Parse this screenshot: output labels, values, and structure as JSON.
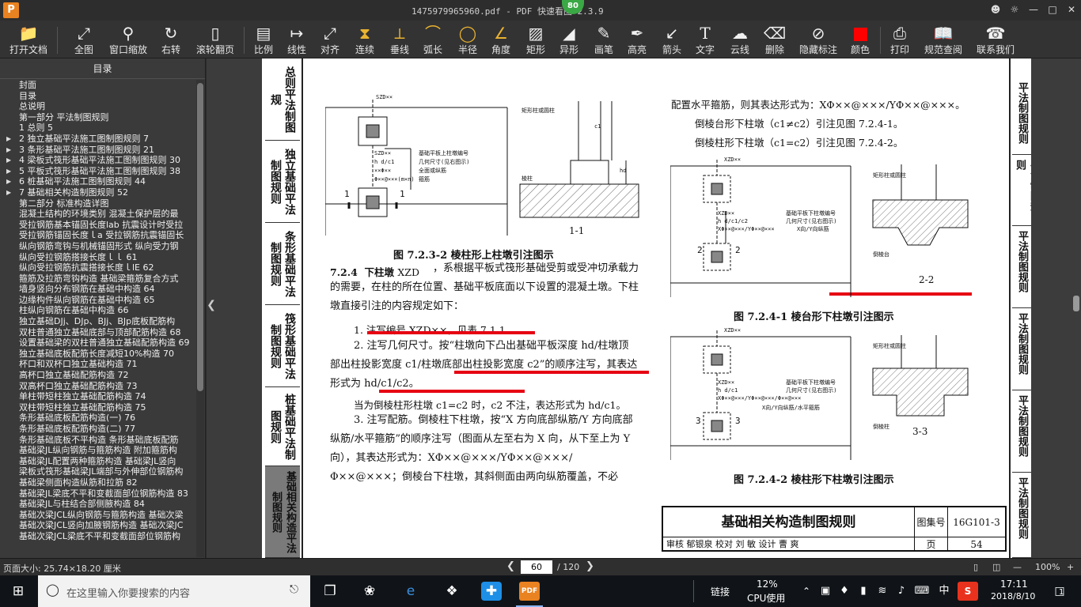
{
  "window": {
    "title": "1475979965960.pdf - PDF 快速看图 2.3.9",
    "badge": "80",
    "app_logo": "P"
  },
  "toolbar": [
    {
      "label": "打开文档",
      "icon": "folder-icon"
    },
    {
      "label": "全图",
      "icon": "fit-page-icon"
    },
    {
      "label": "窗口缩放",
      "icon": "zoom-icon"
    },
    {
      "label": "右转",
      "icon": "rotate-icon"
    },
    {
      "label": "滚轮翻页",
      "icon": "mouse-icon"
    },
    {
      "label": "比例",
      "icon": "scale-icon"
    },
    {
      "label": "线性",
      "icon": "linear-icon"
    },
    {
      "label": "对齐",
      "icon": "align-icon"
    },
    {
      "label": "连续",
      "icon": "continuous-icon"
    },
    {
      "label": "垂线",
      "icon": "perpendicular-icon"
    },
    {
      "label": "弧长",
      "icon": "arc-length-icon"
    },
    {
      "label": "半径",
      "icon": "radius-icon"
    },
    {
      "label": "角度",
      "icon": "angle-icon"
    },
    {
      "label": "矩形",
      "icon": "rectangle-icon"
    },
    {
      "label": "异形",
      "icon": "polygon-icon"
    },
    {
      "label": "画笔",
      "icon": "pen-icon"
    },
    {
      "label": "高亮",
      "icon": "highlight-icon"
    },
    {
      "label": "箭头",
      "icon": "arrow-icon"
    },
    {
      "label": "文字",
      "icon": "text-icon"
    },
    {
      "label": "云线",
      "icon": "cloud-icon"
    },
    {
      "label": "删除",
      "icon": "eraser-icon"
    },
    {
      "label": "隐藏标注",
      "icon": "hide-eye-icon"
    },
    {
      "label": "颜色",
      "icon": "color-swatch-icon"
    },
    {
      "label": "打印",
      "icon": "printer-icon"
    },
    {
      "label": "规范查阅",
      "icon": "book-icon"
    },
    {
      "label": "联系我们",
      "icon": "headset-icon"
    }
  ],
  "colors": {
    "accent_red": "#e60012",
    "swatch": "#ff0000",
    "badge": "#3aa845"
  },
  "toc": {
    "header": "目录",
    "items": [
      {
        "label": "封面",
        "arrow": false
      },
      {
        "label": "目录",
        "arrow": false
      },
      {
        "label": "总说明",
        "arrow": false
      },
      {
        "label": "第一部分  平法制图规则",
        "arrow": false
      },
      {
        "label": "1 总则 5",
        "arrow": false
      },
      {
        "label": "2 独立基础平法施工图制图规则 7",
        "arrow": true
      },
      {
        "label": "3 条形基础平法施工图制图规则 21",
        "arrow": true
      },
      {
        "label": "4 梁板式筏形基础平法施工图制图规则 30",
        "arrow": true
      },
      {
        "label": "5 平板式筏形基础平法施工图制图规则 38",
        "arrow": true
      },
      {
        "label": "6 桩基础平法施工图制图规则 44",
        "arrow": true
      },
      {
        "label": "7 基础相关构造制图规则 52",
        "arrow": true
      },
      {
        "label": "第二部分  标准构造详图",
        "arrow": false
      },
      {
        "label": "混凝土结构的环境类别 混凝土保护层的最",
        "arrow": false
      },
      {
        "label": "受拉钢筋基本锚固长度lab 抗震设计时受拉",
        "arrow": false
      },
      {
        "label": "受拉钢筋锚固长度ｌa 受拉钢筋抗震锚固长",
        "arrow": false
      },
      {
        "label": "纵向钢筋弯钩与机械锚固形式 纵向受力钢",
        "arrow": false
      },
      {
        "label": "纵向受拉钢筋搭接长度ｌｌ 61",
        "arrow": false
      },
      {
        "label": "纵向受拉钢筋抗震搭接长度ｌlE 62",
        "arrow": false
      },
      {
        "label": "箍筋及拉筋弯钩构造 基础梁箍筋复合方式",
        "arrow": false
      },
      {
        "label": "墙身竖向分布钢筋在基础中构造 64",
        "arrow": false
      },
      {
        "label": "边缘构件纵向钢筋在基础中构造 65",
        "arrow": false
      },
      {
        "label": "柱纵向钢筋在基础中构造 66",
        "arrow": false
      },
      {
        "label": "独立基础DJj、DJp、BJj、BJp底板配筋构",
        "arrow": false
      },
      {
        "label": "双柱普通独立基础底部与顶部配筋构造 68",
        "arrow": false
      },
      {
        "label": "设置基础梁的双柱普通独立基础配筋构造 69",
        "arrow": false
      },
      {
        "label": "独立基础底板配筋长度减短10%构造 70",
        "arrow": false
      },
      {
        "label": "杯口和双杯口独立基础构造 71",
        "arrow": false
      },
      {
        "label": "高杯口独立基础配筋构造 72",
        "arrow": false
      },
      {
        "label": "双高杯口独立基础配筋构造 73",
        "arrow": false
      },
      {
        "label": "单柱带短柱独立基础配筋构造 74",
        "arrow": false
      },
      {
        "label": "双柱带短柱独立基础配筋构造 75",
        "arrow": false
      },
      {
        "label": "条形基础底板配筋构造(一) 76",
        "arrow": false
      },
      {
        "label": "条形基础底板配筋构造(二) 77",
        "arrow": false
      },
      {
        "label": "条形基础底板不平构造 条形基础底板配筋",
        "arrow": false
      },
      {
        "label": "基础梁JL纵向钢筋与箍筋构造 附加箍筋构",
        "arrow": false
      },
      {
        "label": "基础梁JL配置两种箍筋构造 基础梁JL竖向",
        "arrow": false
      },
      {
        "label": "梁板式筏形基础梁JL端部与外伸部位钢筋构",
        "arrow": false
      },
      {
        "label": "基础梁侧面构造纵筋和拉筋 82",
        "arrow": false
      },
      {
        "label": "基础梁JL梁底不平和变截面部位钢筋构造 83",
        "arrow": false
      },
      {
        "label": "基础梁JL与柱结合部侧腋构造 84",
        "arrow": false
      },
      {
        "label": "基础次梁JCL纵向钢筋与箍筋构造 基础次梁",
        "arrow": false
      },
      {
        "label": "基础次梁JCL竖向加腋钢筋构造 基础次梁JC",
        "arrow": false
      },
      {
        "label": "基础次梁JCL梁底不平和变截面部位钢筋构",
        "arrow": false
      }
    ]
  },
  "page": {
    "left_tabs": [
      "总则平法制图规",
      "独立基础平法制图规则",
      "条形基础平法制图规则",
      "筏形基础平法制图规则",
      "桩基础平法制图规则",
      "基础相关构造平法制图规则"
    ],
    "right_tabs": [
      "平法制图规则",
      "平法制图规则",
      "平法制图规则",
      "平法制图规则",
      "平法制图规则",
      "平法制图规则"
    ],
    "fig1": {
      "caption": "图 7.2.3-2  棱柱形上柱墩引注图示",
      "section": "1-1",
      "labels": [
        "SZD××",
        "SZD××",
        "h d/c1",
        "××Φ××",
        "Φ××@×××(m×n)",
        "基础平板上柱墩编号",
        "几何尺寸(见右图示)",
        "全面或纵筋",
        "箍筋",
        "矩形柱或圆柱",
        "棱柱",
        "1",
        "1",
        "c1",
        "hd"
      ]
    },
    "section_heading": "7.2.4",
    "section_title": "下柱墩",
    "section_code": "XZD",
    "para1": "，系根据平板式筏形基础受剪或受冲切承载力的需要，在柱的所在位置、基础平板底面以下设置的混凝土墩。下柱墩直接引注的内容规定如下：",
    "item1": "1. 注写编号 XZD××，见表 7.1.1。",
    "item2": "2. 注写几何尺寸。按“柱墩向下凸出基础平板深度 hd/柱墩顶部出柱投影宽度 c1/柱墩底部出柱投影宽度 c2”的顺序注写，其表达形式为 hd/c1/c2。",
    "item2b": "当为倒棱柱形柱墩 c1=c2 时，c2 不注，表达形式为 hd/c1。",
    "item3": "3. 注写配筋。倒棱柱下柱墩，按“X 方向底部纵筋/Y 方向底部纵筋/水平箍筋”的顺序注写（图面从左至右为 X 向，从下至上为 Y 向），其表达形式为：XΦ××@×××/YΦ××@×××/Φ××@×××；倒棱台下柱墩，其斜侧面由两向纵筋覆盖，不必",
    "right_p1": "配置水平箍筋，则其表达形式为：XΦ××@×××/YΦ××@×××。",
    "right_p2": "倒棱台形下柱墩（c1≠c2）引注见图 7.2.4-1。",
    "right_p3": "倒棱柱形下柱墩（c1=c2）引注见图 7.2.4-2。",
    "fig2": {
      "caption": "图 7.2.4-1  棱台形下柱墩引注图示",
      "section": "2-2",
      "labels": [
        "XZD××",
        "XZD××",
        "h d/c1/c2",
        "XΦ××@×××/YΦ××@×××",
        "基础平板下柱墩编号",
        "几何尺寸(见右图示)",
        "X向/Y向纵筋",
        "矩形柱或圆柱",
        "倒棱台",
        "2",
        "2"
      ]
    },
    "fig3": {
      "caption": "图 7.2.4-2  棱柱形下柱墩引注图示",
      "section": "3-3",
      "labels": [
        "XZD××",
        "XZD××",
        "h d/c1",
        "XΦ××@×××/YΦ××@×××/Φ××@×××",
        "基础平板下柱墩编号",
        "几何尺寸(见右图示)",
        "X向/Y向纵筋/水平箍筋",
        "矩形柱或圆柱",
        "倒棱柱",
        "3",
        "3"
      ]
    },
    "titleblock": {
      "title": "基础相关构造制图规则",
      "atlas_label": "图集号",
      "atlas_no": "16G101-3",
      "sig_row": "审核  郁银泉  校对  刘  敏  设计  曹  爽",
      "page_label": "页",
      "page_no": "54"
    }
  },
  "status": {
    "page_size": "页面大小: 25.74×18.20 厘米",
    "current_page": "60",
    "total_pages": "/ 120",
    "zoom": "100%"
  },
  "taskbar": {
    "search_placeholder": "在这里输入你要搜索的内容",
    "network": "链接",
    "cpu_percent": "12%",
    "cpu_label": "CPU使用",
    "ime": "中",
    "time": "17:11",
    "date": "2018/8/10",
    "notification_count": "1"
  }
}
